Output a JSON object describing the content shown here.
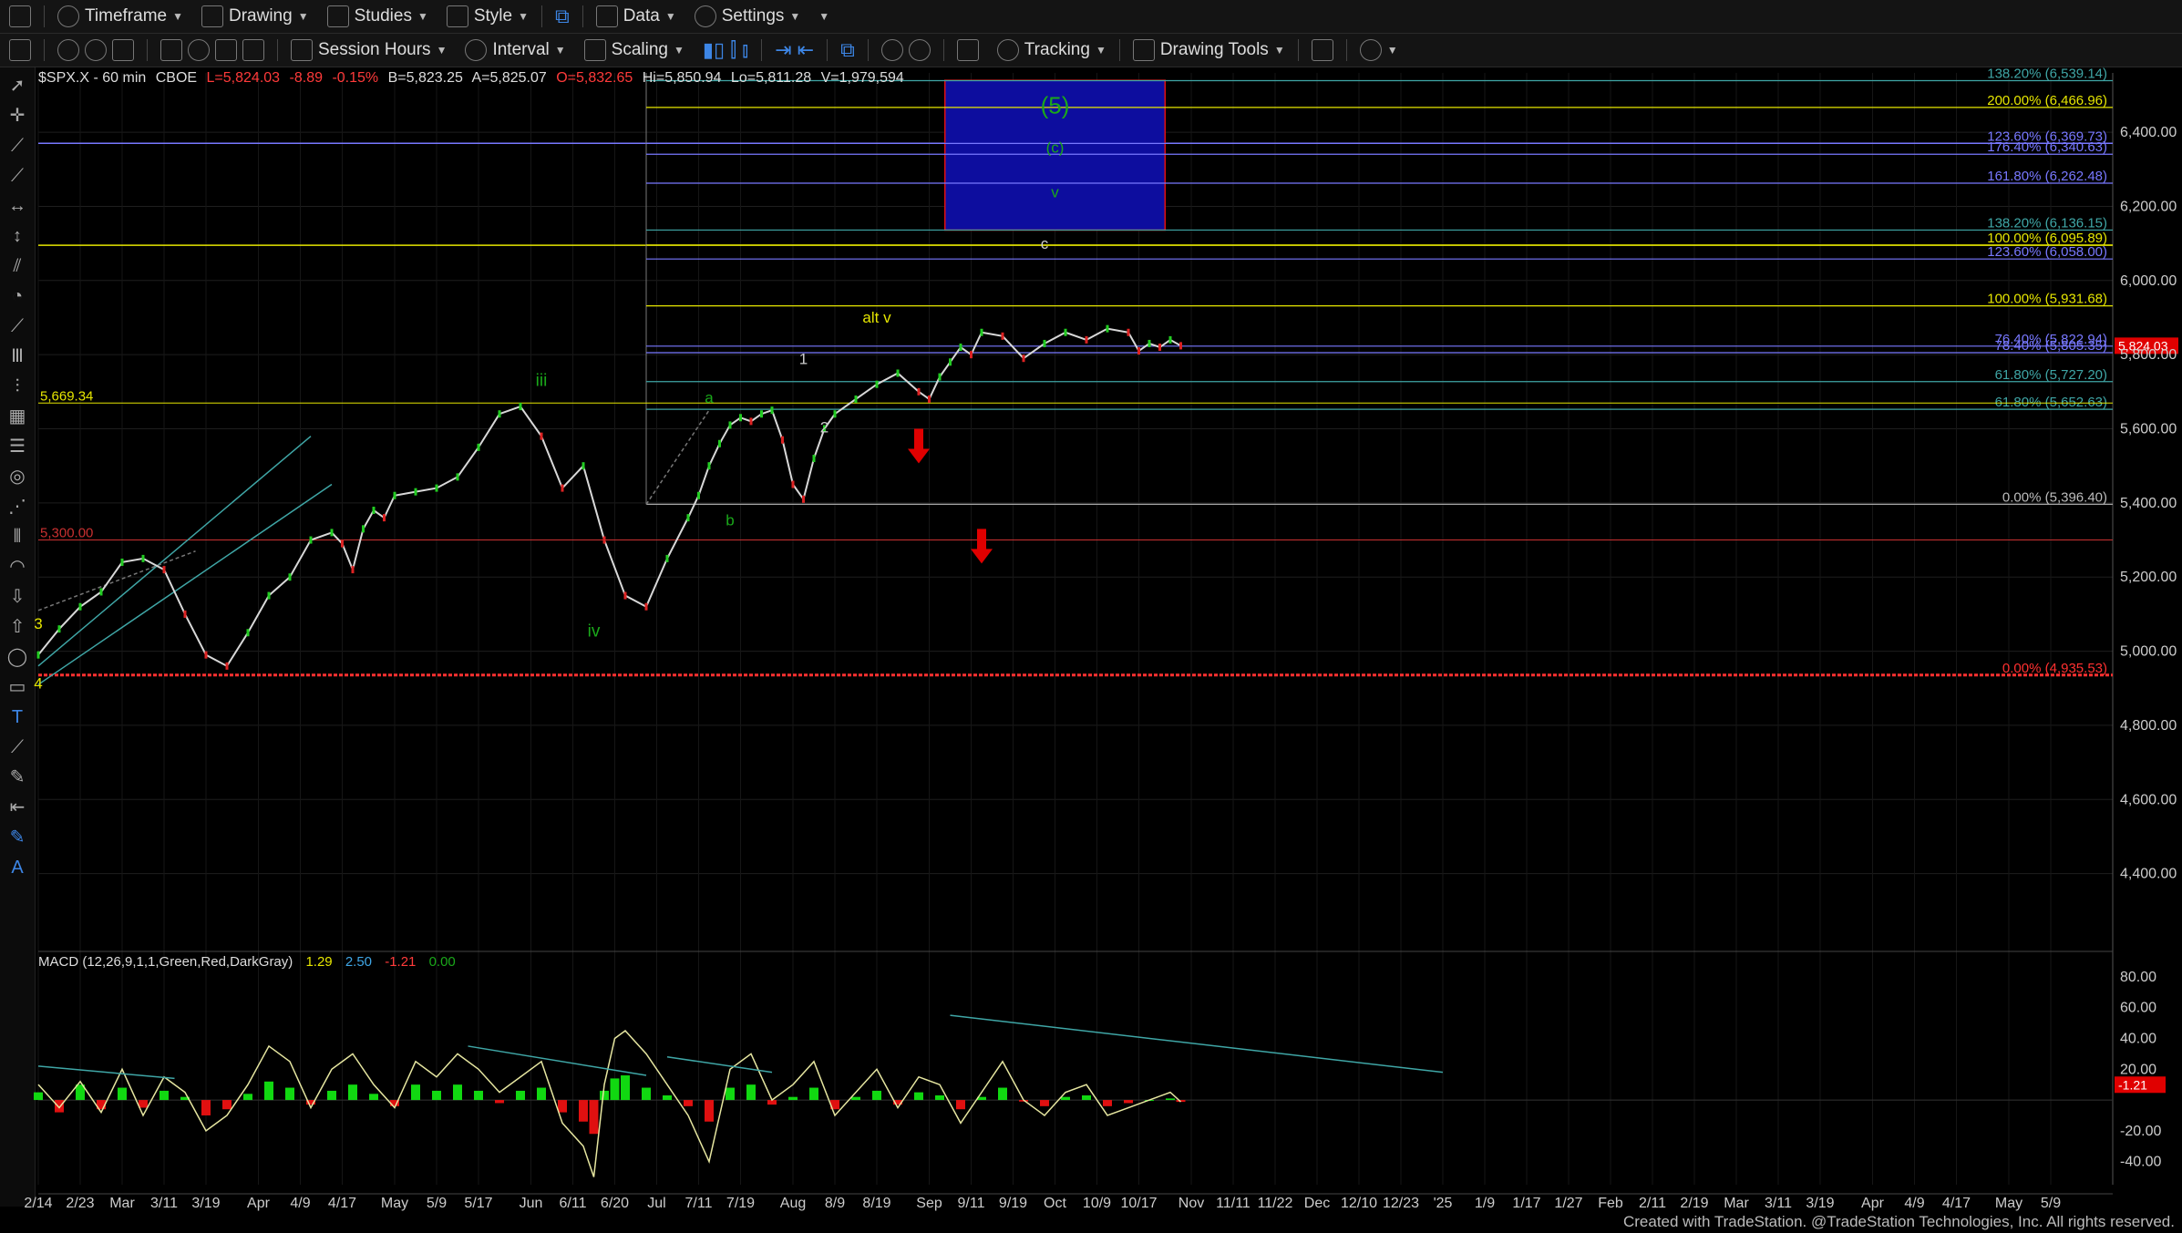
{
  "toolbar1": {
    "timeframe": "Timeframe",
    "drawing": "Drawing",
    "studies": "Studies",
    "style": "Style",
    "data": "Data",
    "settings": "Settings"
  },
  "toolbar2": {
    "session_hours": "Session Hours",
    "interval": "Interval",
    "scaling": "Scaling",
    "tracking": "Tracking",
    "drawing_tools": "Drawing Tools"
  },
  "header": {
    "symbol": "$SPX.X - 60 min",
    "exchange": "CBOE",
    "last": "L=5,824.03",
    "change": "-8.89",
    "change_pct": "-0.15%",
    "bid": "B=5,823.25",
    "ask": "A=5,825.07",
    "open": "O=5,832.65",
    "high": "Hi=5,850.94",
    "low": "Lo=5,811.28",
    "volume": "V=1,979,594"
  },
  "macd_header": {
    "label": "MACD (12,26,9,1,1,Green,Red,DarkGray)",
    "v1": "1.29",
    "v2": "2.50",
    "v3": "-1.21",
    "v4": "0.00"
  },
  "footer": "Created with TradeStation. @TradeStation Technologies, Inc. All rights reserved.",
  "colors": {
    "background": "#000000",
    "fib_yellow": "#e6e600",
    "fib_blue": "#7878ff",
    "fib_teal": "#3fa6a6",
    "wave_green": "#1aa81a",
    "target_box": "#0d0d9e",
    "arrow_red": "#e00000",
    "macd_up": "#11d811",
    "macd_down": "#e01010"
  },
  "chart_data": {
    "type": "line",
    "title": "$SPX.X - 60 min",
    "price_axis": {
      "range": [
        4200,
        6560
      ],
      "ticks": [
        "6,400.00",
        "6,200.00",
        "6,000.00",
        "5,800.00",
        "5,600.00",
        "5,400.00",
        "5,200.00",
        "5,000.00",
        "4,800.00",
        "4,600.00",
        "4,400.00"
      ],
      "tick_values": [
        6400,
        6200,
        6000,
        5800,
        5600,
        5400,
        5200,
        5000,
        4800,
        4600,
        4400
      ]
    },
    "time_axis": {
      "labels": [
        "2/14",
        "2/23",
        "Mar",
        "3/11",
        "3/19",
        "Apr",
        "4/9",
        "4/17",
        "May",
        "5/9",
        "5/17",
        "Jun",
        "6/11",
        "6/20",
        "Jul",
        "7/11",
        "7/19",
        "Aug",
        "8/9",
        "8/19",
        "Sep",
        "9/11",
        "9/19",
        "Oct",
        "10/9",
        "10/17",
        "Nov",
        "11/11",
        "11/22",
        "Dec",
        "12/10",
        "12/23",
        "'25",
        "1/9",
        "1/17",
        "1/27",
        "Feb",
        "2/11",
        "2/19",
        "Mar",
        "3/11",
        "3/19",
        "Apr",
        "4/9",
        "4/17",
        "May",
        "5/9"
      ],
      "label_index": [
        0,
        4,
        8,
        12,
        16,
        21,
        25,
        29,
        34,
        38,
        42,
        47,
        51,
        55,
        59,
        63,
        67,
        72,
        76,
        80,
        85,
        89,
        93,
        97,
        101,
        105,
        110,
        114,
        118,
        122,
        126,
        130,
        134,
        138,
        142,
        146,
        150,
        154,
        158,
        162,
        166,
        170,
        175,
        179,
        183,
        188,
        192
      ]
    },
    "price_series": {
      "name": "",
      "x": [
        0,
        2,
        4,
        6,
        8,
        10,
        12,
        14,
        16,
        18,
        20,
        22,
        24,
        26,
        28,
        29,
        30,
        31,
        32,
        33,
        34,
        36,
        38,
        40,
        42,
        44,
        46,
        48,
        50,
        52,
        54,
        56,
        58,
        60,
        62,
        63,
        64,
        65,
        66,
        67,
        68,
        69,
        70,
        71,
        72,
        73,
        74,
        75,
        76,
        78,
        80,
        82,
        84,
        85,
        86,
        87,
        88,
        89,
        90,
        92,
        94,
        96,
        98,
        100,
        102,
        104,
        105,
        106,
        107,
        108,
        109
      ],
      "y": [
        4990,
        5060,
        5120,
        5160,
        5240,
        5250,
        5220,
        5100,
        4990,
        4960,
        5050,
        5150,
        5200,
        5300,
        5320,
        5290,
        5220,
        5330,
        5380,
        5360,
        5420,
        5430,
        5440,
        5470,
        5550,
        5640,
        5660,
        5580,
        5440,
        5500,
        5300,
        5150,
        5120,
        5250,
        5360,
        5420,
        5500,
        5560,
        5610,
        5630,
        5620,
        5640,
        5650,
        5570,
        5450,
        5410,
        5520,
        5600,
        5640,
        5680,
        5720,
        5750,
        5700,
        5680,
        5740,
        5780,
        5820,
        5800,
        5860,
        5850,
        5790,
        5830,
        5860,
        5840,
        5870,
        5860,
        5810,
        5830,
        5820,
        5840,
        5824
      ]
    },
    "fib_levels": [
      {
        "pct": "138.20%",
        "value": 6539.14,
        "label": "138.20% (6,539.14)",
        "color": "#3fa6a6"
      },
      {
        "pct": "200.00%",
        "value": 6466.96,
        "label": "200.00% (6,466.96)",
        "color": "#e6e600"
      },
      {
        "pct": "123.60%",
        "value": 6369.73,
        "label": "123.60% (6,369.73)",
        "color": "#7878ff"
      },
      {
        "pct": "176.40%",
        "value": 6340.63,
        "label": "176.40% (6,340.63)",
        "color": "#7878ff"
      },
      {
        "pct": "161.80%",
        "value": 6262.48,
        "label": "161.80% (6,262.48)",
        "color": "#7878ff"
      },
      {
        "pct": "138.20%",
        "value": 6136.15,
        "label": "138.20% (6,136.15)",
        "color": "#3fa6a6"
      },
      {
        "pct": "100.00%",
        "value": 6095.89,
        "label": "100.00% (6,095.89)",
        "color": "#e6e600"
      },
      {
        "pct": "123.60%",
        "value": 6058.0,
        "label": "123.60% (6,058.00)",
        "color": "#7878ff"
      },
      {
        "pct": "100.00%",
        "value": 5931.68,
        "label": "100.00% (5,931.68)",
        "color": "#e6e600"
      },
      {
        "pct": "76.40%",
        "value": 5822.94,
        "label": "76.40% (5,822.94)",
        "color": "#7878ff"
      },
      {
        "pct": "78.40%",
        "value": 5805.35,
        "label": "78.40% (5,805.35)",
        "color": "#7878ff"
      },
      {
        "pct": "61.80%",
        "value": 5727.2,
        "label": "61.80% (5,727.20)",
        "color": "#3fa6a6"
      },
      {
        "pct": "61.80%",
        "value": 5652.63,
        "label": "61.80% (5,652.63)",
        "color": "#3fa6a6"
      },
      {
        "pct": "0.00%",
        "value": 5396.4,
        "label": "0.00% (5,396.40)",
        "color": "#bbbbbb"
      },
      {
        "pct": "0.00%",
        "value": 4935.53,
        "label": "0.00% (4,935.53)",
        "color": "#ff3030"
      }
    ],
    "price_lines": [
      {
        "value": 5669.34,
        "label": "5,669.34",
        "color": "#e6e600"
      },
      {
        "value": 5300.0,
        "label": "5,300.00",
        "color": "#c83030"
      },
      {
        "value": 5824.03,
        "label": "5,824.03",
        "color": "#e00000"
      }
    ],
    "full_width_lines": [
      {
        "value": 6370,
        "color": "#7878ff"
      },
      {
        "value": 6095,
        "color": "#e6e600"
      }
    ],
    "target_box": {
      "x0": 86.5,
      "x1": 107.5,
      "top": 6540,
      "bottom": 6136
    },
    "wave_labels": [
      {
        "text": "(5)",
        "x": 97,
        "y": 6450,
        "color": "#1aa81a",
        "size": 26
      },
      {
        "text": "(c)",
        "x": 97,
        "y": 6345,
        "color": "#1aa81a",
        "size": 17
      },
      {
        "text": "v",
        "x": 97,
        "y": 6225,
        "color": "#1aa81a",
        "size": 17
      },
      {
        "text": "c",
        "x": 96,
        "y": 6085,
        "color": "#cccccc",
        "size": 17
      },
      {
        "text": "alt v",
        "x": 80,
        "y": 5887,
        "color": "#e6e600",
        "size": 17
      },
      {
        "text": "1",
        "x": 73,
        "y": 5775,
        "color": "#cccccc",
        "size": 17
      },
      {
        "text": "2",
        "x": 75,
        "y": 5590,
        "color": "#cccccc",
        "size": 17
      },
      {
        "text": "iii",
        "x": 48,
        "y": 5715,
        "color": "#1aa81a",
        "size": 19
      },
      {
        "text": "a",
        "x": 64,
        "y": 5670,
        "color": "#1aa81a",
        "size": 17
      },
      {
        "text": "b",
        "x": 66,
        "y": 5340,
        "color": "#1aa81a",
        "size": 17
      },
      {
        "text": "iv",
        "x": 53,
        "y": 5040,
        "color": "#1aa81a",
        "size": 19
      },
      {
        "text": "3",
        "x": 0,
        "y": 5060,
        "color": "#e6e600",
        "size": 17
      },
      {
        "text": "4",
        "x": 0,
        "y": 4900,
        "color": "#e6e600",
        "size": 17
      }
    ],
    "red_arrows": [
      {
        "x": 84,
        "y": 5600
      },
      {
        "x": 90,
        "y": 5330
      }
    ],
    "channel_lines": [
      {
        "x0": 0,
        "y0": 4960,
        "x1": 26,
        "y1": 5580,
        "color": "#3fa6a6"
      },
      {
        "x0": 0,
        "y0": 4910,
        "x1": 28,
        "y1": 5450,
        "color": "#3fa6a6"
      },
      {
        "x0": 0,
        "y0": 5110,
        "x1": 15,
        "y1": 5270,
        "color": "#777777"
      },
      {
        "x0": 58,
        "y0": 5396,
        "x1": 64,
        "y1": 5650,
        "color": "#777777"
      }
    ],
    "macd": {
      "y_ticks": [
        "80.00",
        "60.00",
        "40.00",
        "20.00",
        "-20.00",
        "-40.00"
      ],
      "tick_values": [
        80,
        60,
        40,
        20,
        -20,
        -40
      ],
      "range": [
        -55,
        90
      ],
      "value_readout": "-1.21",
      "x": [
        0,
        2,
        4,
        6,
        8,
        10,
        12,
        14,
        16,
        18,
        20,
        22,
        24,
        26,
        28,
        30,
        32,
        34,
        36,
        38,
        40,
        42,
        44,
        46,
        48,
        50,
        52,
        53,
        54,
        55,
        56,
        58,
        60,
        62,
        64,
        66,
        68,
        70,
        72,
        74,
        76,
        78,
        80,
        82,
        84,
        86,
        88,
        90,
        92,
        94,
        96,
        98,
        100,
        102,
        104,
        106,
        108,
        109
      ],
      "line": [
        10,
        -5,
        12,
        -8,
        20,
        -10,
        15,
        5,
        -20,
        -10,
        10,
        35,
        25,
        -5,
        20,
        30,
        10,
        -5,
        25,
        15,
        30,
        20,
        5,
        15,
        25,
        -15,
        -30,
        -50,
        10,
        40,
        45,
        30,
        10,
        -10,
        -40,
        20,
        30,
        0,
        10,
        25,
        -10,
        5,
        20,
        -5,
        15,
        10,
        -15,
        5,
        25,
        0,
        -10,
        5,
        10,
        -10,
        -5,
        0,
        5,
        -1.21
      ],
      "histogram": [
        5,
        -8,
        10,
        -6,
        8,
        -5,
        6,
        2,
        -10,
        -6,
        4,
        12,
        8,
        -3,
        6,
        10,
        4,
        -4,
        10,
        6,
        10,
        6,
        -2,
        6,
        8,
        -8,
        -14,
        -22,
        6,
        14,
        16,
        8,
        3,
        -4,
        -14,
        8,
        10,
        -3,
        2,
        8,
        -6,
        2,
        6,
        -3,
        5,
        3,
        -6,
        2,
        8,
        -1,
        -4,
        2,
        3,
        -4,
        -2,
        0,
        1,
        -1.21
      ],
      "trend_lines": [
        {
          "x0": 0,
          "y0": 22,
          "x1": 13,
          "y1": 14
        },
        {
          "x0": 41,
          "y0": 35,
          "x1": 58,
          "y1": 16
        },
        {
          "x0": 60,
          "y0": 28,
          "x1": 70,
          "y1": 18
        },
        {
          "x0": 87,
          "y0": 55,
          "x1": 134,
          "y1": 18
        }
      ]
    }
  }
}
